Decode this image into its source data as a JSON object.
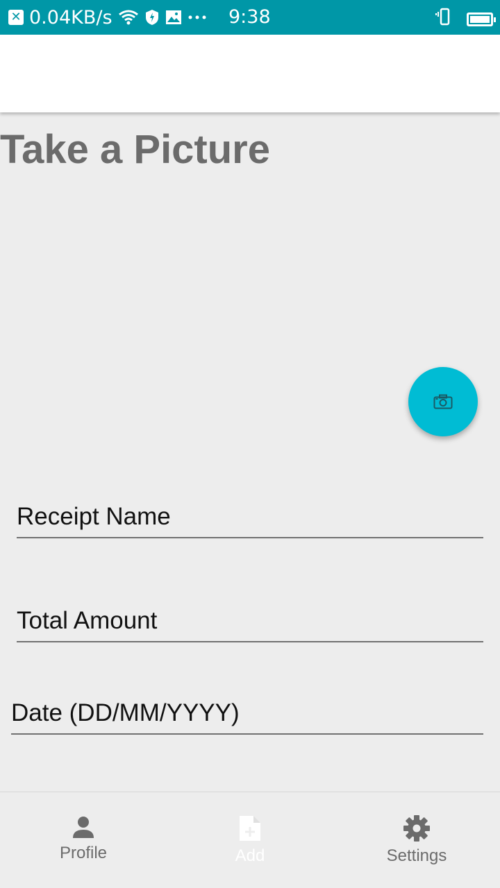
{
  "status_bar": {
    "speed": "0.04KB/s",
    "time": "9:38"
  },
  "page": {
    "title": "Take a Picture"
  },
  "fab": {
    "icon": "camera-icon",
    "color": "#00bcd4"
  },
  "form": {
    "receipt_name_placeholder": "Receipt Name",
    "total_amount_placeholder": "Total Amount",
    "date_placeholder": "Date (DD/MM/YYYY)"
  },
  "bottom_nav": {
    "items": [
      {
        "label": "Profile",
        "icon": "person-icon"
      },
      {
        "label": "Add",
        "icon": "add-file-icon"
      },
      {
        "label": "Settings",
        "icon": "gear-icon"
      }
    ]
  },
  "colors": {
    "status_bar": "#0097a7",
    "background": "#ededed",
    "accent": "#00bcd4"
  }
}
